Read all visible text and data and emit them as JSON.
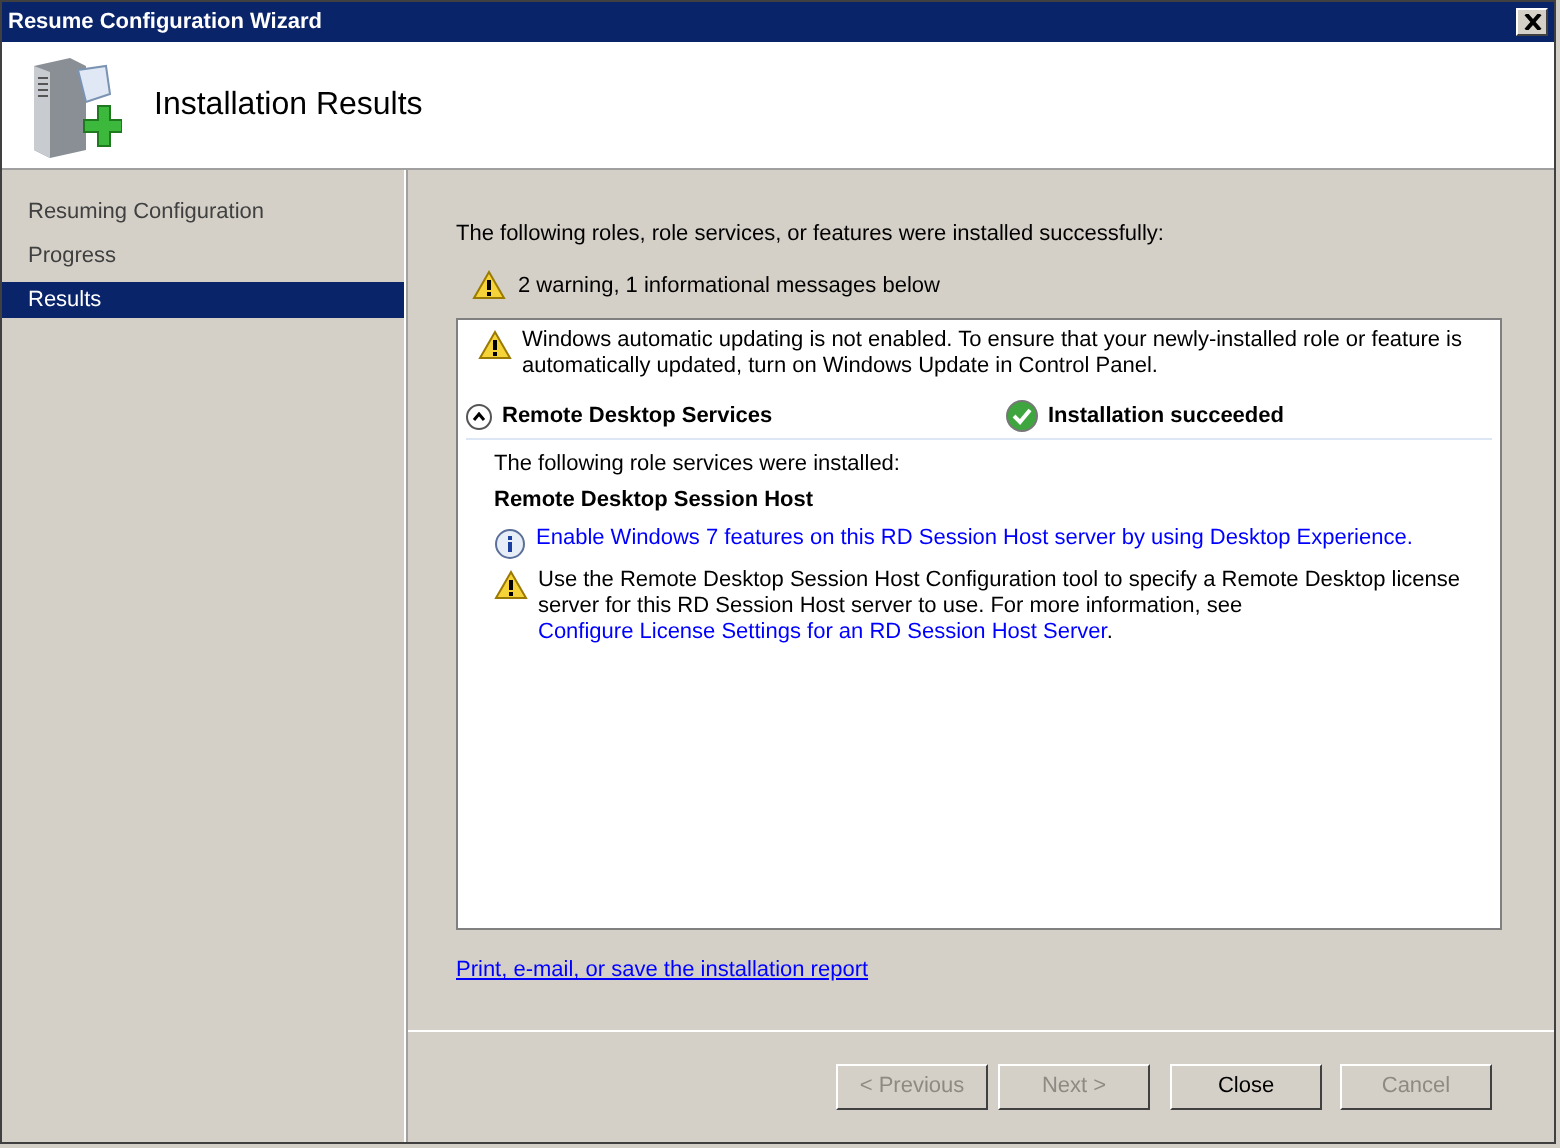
{
  "window": {
    "title": "Resume Configuration Wizard"
  },
  "header": {
    "title": "Installation Results"
  },
  "sidebar": {
    "items": [
      {
        "label": "Resuming Configuration",
        "selected": false
      },
      {
        "label": "Progress",
        "selected": false
      },
      {
        "label": "Results",
        "selected": true
      }
    ]
  },
  "intro": "The following roles, role services, or features were installed successfully:",
  "summary": {
    "kind": "warning",
    "text": "2 warning, 1 informational messages below"
  },
  "results": {
    "top_message": {
      "kind": "warning",
      "parts": [
        {
          "text": "Windows automatic updating is not enabled. To ensure that your newly-installed role or feature is automatically updated, turn on Windows Update in Control Panel.",
          "link": false
        }
      ]
    },
    "role": {
      "name": "Remote Desktop Services",
      "expanded": true,
      "status": "Installation succeeded"
    },
    "installed_label": "The following role services were installed:",
    "service": "Remote Desktop Session Host",
    "messages": [
      {
        "kind": "info",
        "parts": [
          {
            "text": "Enable Windows 7 features on this RD Session Host server by using Desktop Experience.",
            "link": true
          }
        ]
      },
      {
        "kind": "warning",
        "parts": [
          {
            "text": "Use the Remote Desktop Session Host Configuration tool to specify a Remote Desktop license server for this RD Session Host server to use. For more information, see ",
            "link": false
          },
          {
            "text": "Configure License Settings for an RD Session Host Server",
            "link": true
          },
          {
            "text": ".",
            "link": false
          }
        ]
      }
    ]
  },
  "report_link": "Print, e-mail, or save the installation report",
  "buttons": [
    {
      "label": "< Previous",
      "disabled": true
    },
    {
      "label": "Next >",
      "disabled": true
    },
    {
      "label": "Close",
      "disabled": false
    },
    {
      "label": "Cancel",
      "disabled": true
    }
  ]
}
